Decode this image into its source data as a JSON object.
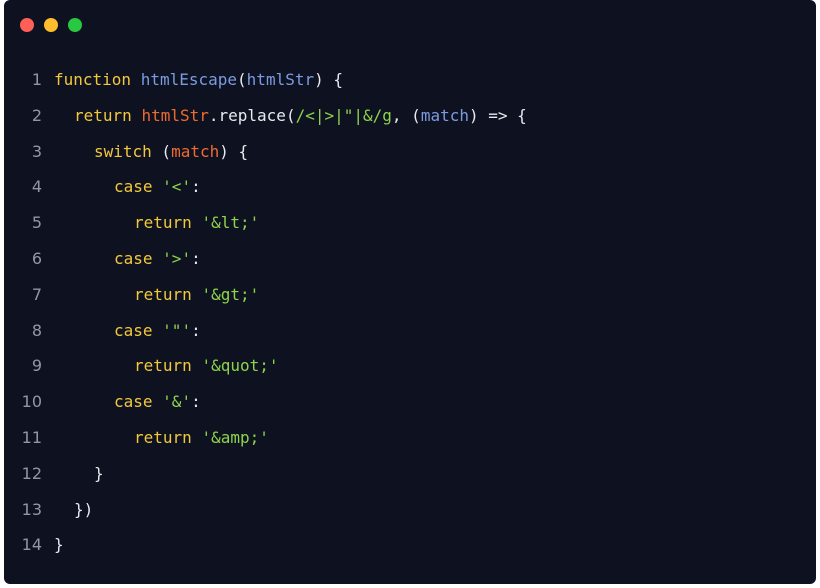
{
  "window": {
    "traffic_lights": [
      {
        "name": "close",
        "color": "#ff5f57"
      },
      {
        "name": "minimize",
        "color": "#febc2e"
      },
      {
        "name": "zoom",
        "color": "#28c840"
      }
    ]
  },
  "colors": {
    "keyword": "#f2c83c",
    "function": "#7b9be0",
    "variable": "#ee6b2f",
    "string": "#8ed44b",
    "punctuation": "#e8eaf0",
    "background": "#0e1220"
  },
  "code_lines": [
    {
      "number": "1",
      "indent": 0,
      "tokens": [
        {
          "t": "function",
          "c": "kw"
        },
        {
          "t": " ",
          "c": "plain"
        },
        {
          "t": "htmlEscape",
          "c": "fn"
        },
        {
          "t": "(",
          "c": "punc"
        },
        {
          "t": "htmlStr",
          "c": "fn"
        },
        {
          "t": ") {",
          "c": "punc"
        }
      ]
    },
    {
      "number": "2",
      "indent": 1,
      "tokens": [
        {
          "t": "return",
          "c": "kw"
        },
        {
          "t": " ",
          "c": "plain"
        },
        {
          "t": "htmlStr",
          "c": "var"
        },
        {
          "t": ".replace(",
          "c": "punc"
        },
        {
          "t": "/<|>|\"|&/g",
          "c": "str"
        },
        {
          "t": ", (",
          "c": "punc"
        },
        {
          "t": "match",
          "c": "fn"
        },
        {
          "t": ") => {",
          "c": "punc"
        }
      ]
    },
    {
      "number": "3",
      "indent": 2,
      "tokens": [
        {
          "t": "switch",
          "c": "kw"
        },
        {
          "t": " (",
          "c": "punc"
        },
        {
          "t": "match",
          "c": "var"
        },
        {
          "t": ") {",
          "c": "punc"
        }
      ]
    },
    {
      "number": "4",
      "indent": 3,
      "tokens": [
        {
          "t": "case",
          "c": "kw"
        },
        {
          "t": " ",
          "c": "plain"
        },
        {
          "t": "'<'",
          "c": "str"
        },
        {
          "t": ":",
          "c": "punc"
        }
      ]
    },
    {
      "number": "5",
      "indent": 4,
      "tokens": [
        {
          "t": "return",
          "c": "kw"
        },
        {
          "t": " ",
          "c": "plain"
        },
        {
          "t": "'&lt;'",
          "c": "str"
        }
      ]
    },
    {
      "number": "6",
      "indent": 3,
      "tokens": [
        {
          "t": "case",
          "c": "kw"
        },
        {
          "t": " ",
          "c": "plain"
        },
        {
          "t": "'>'",
          "c": "str"
        },
        {
          "t": ":",
          "c": "punc"
        }
      ]
    },
    {
      "number": "7",
      "indent": 4,
      "tokens": [
        {
          "t": "return",
          "c": "kw"
        },
        {
          "t": " ",
          "c": "plain"
        },
        {
          "t": "'&gt;'",
          "c": "str"
        }
      ]
    },
    {
      "number": "8",
      "indent": 3,
      "tokens": [
        {
          "t": "case",
          "c": "kw"
        },
        {
          "t": " ",
          "c": "plain"
        },
        {
          "t": "'\"'",
          "c": "str"
        },
        {
          "t": ":",
          "c": "punc"
        }
      ]
    },
    {
      "number": "9",
      "indent": 4,
      "tokens": [
        {
          "t": "return",
          "c": "kw"
        },
        {
          "t": " ",
          "c": "plain"
        },
        {
          "t": "'&quot;'",
          "c": "str"
        }
      ]
    },
    {
      "number": "10",
      "indent": 3,
      "tokens": [
        {
          "t": "case",
          "c": "kw"
        },
        {
          "t": " ",
          "c": "plain"
        },
        {
          "t": "'&'",
          "c": "str"
        },
        {
          "t": ":",
          "c": "punc"
        }
      ]
    },
    {
      "number": "11",
      "indent": 4,
      "tokens": [
        {
          "t": "return",
          "c": "kw"
        },
        {
          "t": " ",
          "c": "plain"
        },
        {
          "t": "'&amp;'",
          "c": "str"
        }
      ]
    },
    {
      "number": "12",
      "indent": 2,
      "tokens": [
        {
          "t": "}",
          "c": "punc"
        }
      ]
    },
    {
      "number": "13",
      "indent": 1,
      "tokens": [
        {
          "t": "})",
          "c": "punc"
        }
      ]
    },
    {
      "number": "14",
      "indent": 0,
      "tokens": [
        {
          "t": "}",
          "c": "punc"
        }
      ]
    }
  ]
}
